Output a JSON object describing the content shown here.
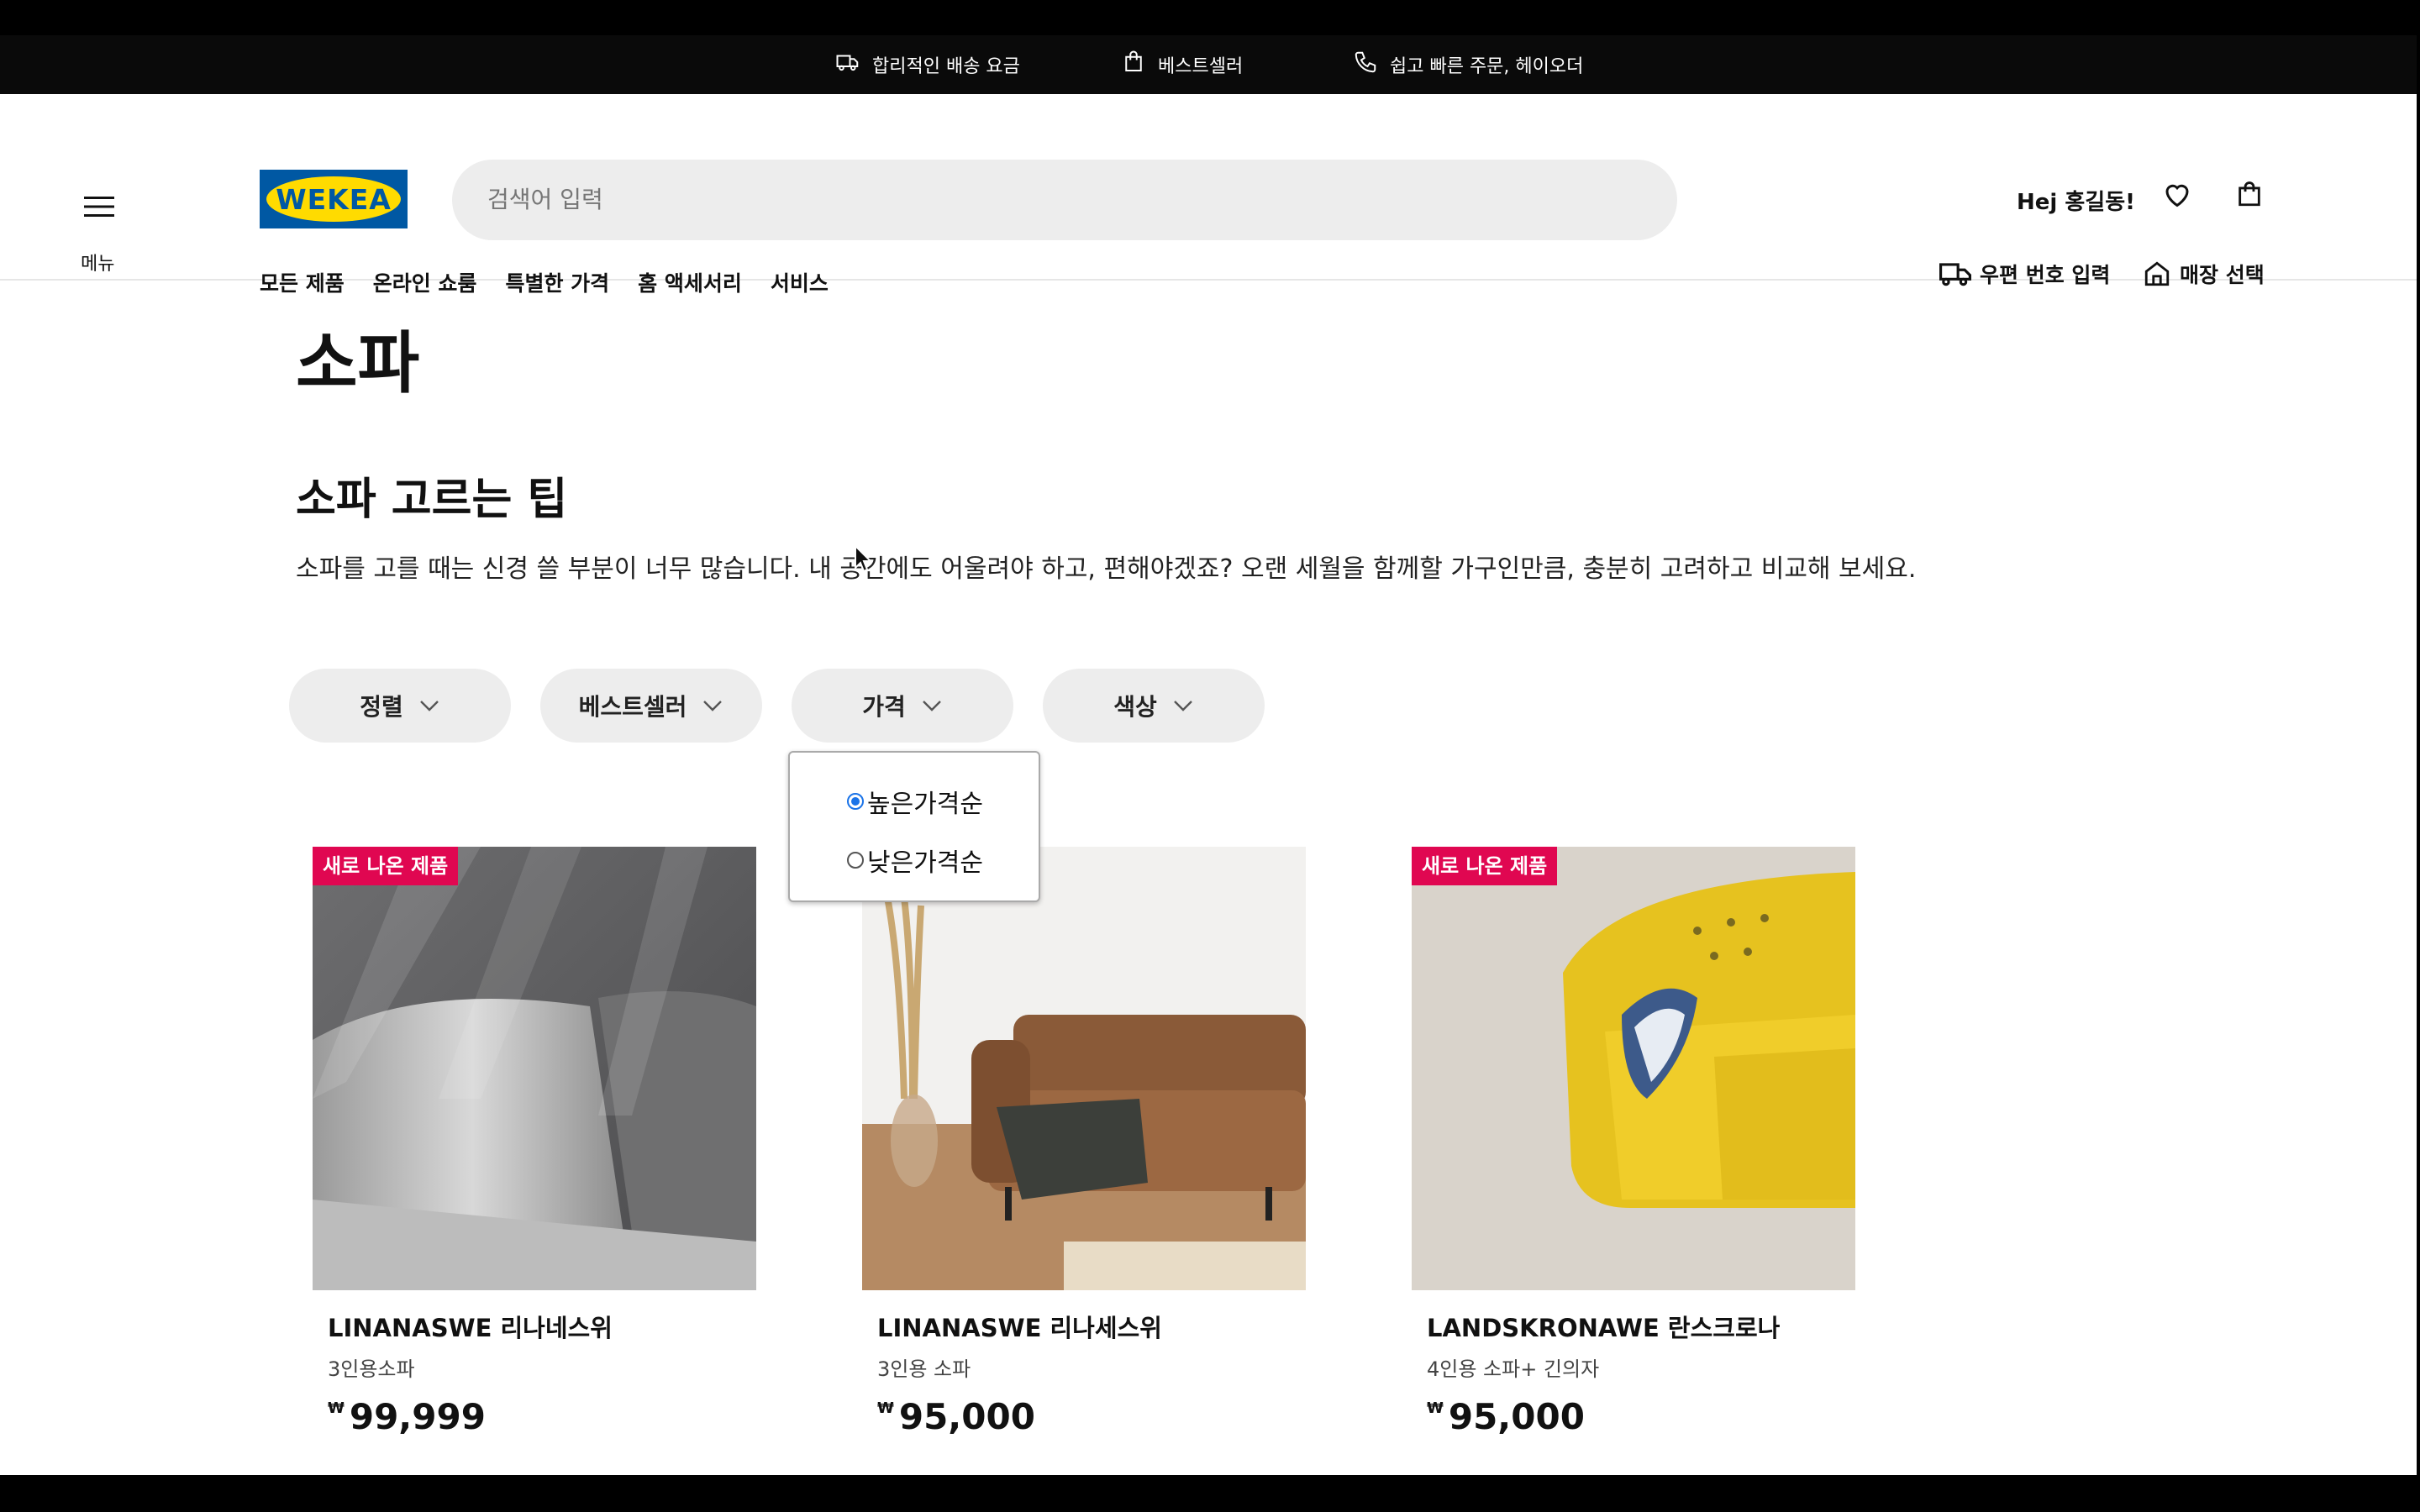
{
  "promo_bar": {
    "items": [
      {
        "icon": "truck-icon",
        "label": "합리적인 배송 요금"
      },
      {
        "icon": "shopping-bag-icon",
        "label": "베스트셀러"
      },
      {
        "icon": "phone-icon",
        "label": "쉽고 빠른 주문, 헤이오더"
      }
    ]
  },
  "header": {
    "menu_label": "메뉴",
    "logo_text": "WEKEA",
    "search_placeholder": "검색어 입력",
    "greeting": "Hej 홍길동!",
    "nav": [
      "모든 제품",
      "온라인 쇼룸",
      "특별한 가격",
      "홈 액세서리",
      "서비스"
    ],
    "postal_code_label": "우편 번호 입력",
    "store_select_label": "매장 선택"
  },
  "content": {
    "page_title": "소파",
    "tips_title": "소파 고르는 팁",
    "tips_text": "소파를 고를 때는 신경 쓸 부분이 너무 많습니다. 내 공간에도 어울려야 하고, 편해야겠죠? 오랜 세월을 함께할 가구인만큼, 충분히 고려하고 비교해 보세요."
  },
  "filters": [
    "정렬",
    "베스트셀러",
    "가격",
    "색상"
  ],
  "price_dropdown": {
    "options": [
      {
        "label": "높은가격순",
        "selected": true
      },
      {
        "label": "낮은가격순",
        "selected": false
      }
    ]
  },
  "products": [
    {
      "badge": "새로 나온 제품",
      "name": "LINANASWE 리나네스위",
      "desc": "3인용소파",
      "currency": "₩",
      "price": "99,999"
    },
    {
      "badge": "",
      "name": "LINANASWE 리나세스위",
      "desc": "3인용 소파",
      "currency": "₩",
      "price": "95,000"
    },
    {
      "badge": "새로 나온 제품",
      "name": "LANDSKRONAWE 란스크로나",
      "desc": "4인용 소파+ 긴의자",
      "currency": "₩",
      "price": "95,000"
    }
  ],
  "colors": {
    "brand_blue": "#0058a3",
    "brand_yellow": "#ffdb00",
    "badge_red": "#e00751",
    "radio_selected": "#1a73e8"
  }
}
